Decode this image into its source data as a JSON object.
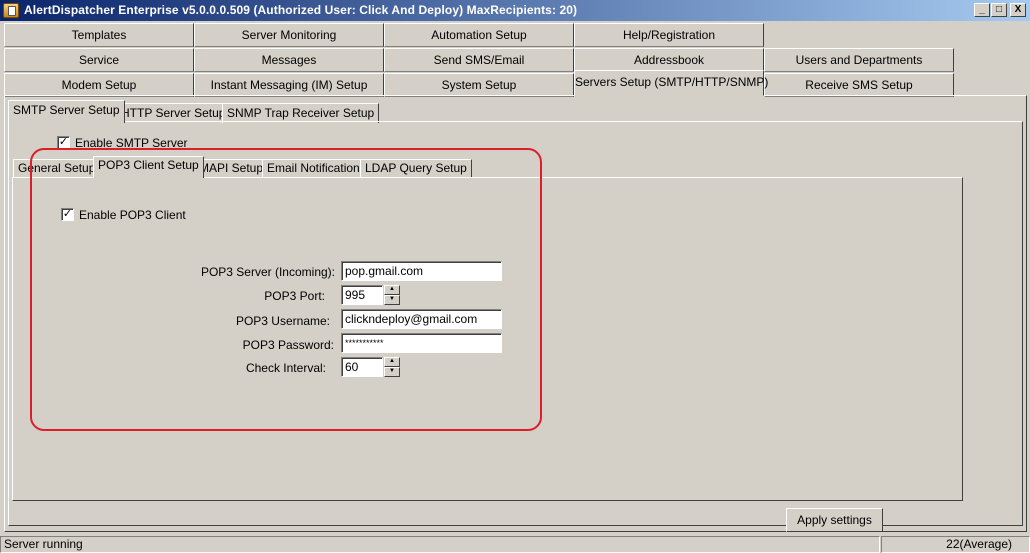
{
  "window": {
    "title": "AlertDispatcher Enterprise v5.0.0.0.509 (Authorized User: Click And Deploy)   MaxRecipients: 20)",
    "controls": {
      "minimize": "_",
      "maximize": "□",
      "close": "X"
    }
  },
  "main_tabs": {
    "row1": [
      "Templates",
      "Server Monitoring",
      "Automation Setup",
      "Help/Registration"
    ],
    "row2": [
      "Service",
      "Messages",
      "Send SMS/Email",
      "Addressbook",
      "Users and Departments"
    ],
    "row3": [
      "Modem Setup",
      "Instant Messaging (IM) Setup",
      "System Setup",
      "Servers Setup (SMTP/HTTP/SNMP)",
      "Receive SMS Setup"
    ],
    "active": "Servers Setup (SMTP/HTTP/SNMP)"
  },
  "server_tabs": {
    "items": [
      "SMTP Server Setup",
      "HTTP Server Setup",
      "SNMP Trap Receiver Setup"
    ],
    "active": "SMTP Server Setup"
  },
  "smtp": {
    "enable_label": "Enable SMTP Server",
    "enabled": true
  },
  "smtp_tabs": {
    "items": [
      "General Setup",
      "POP3 Client Setup",
      "MAPI Setup",
      "Email Notifications",
      "LDAP Query Setup"
    ],
    "active": "POP3 Client Setup"
  },
  "pop3": {
    "enable_label": "Enable POP3 Client",
    "enabled": true,
    "server_label": "POP3 Server (Incoming):",
    "server_value": "pop.gmail.com",
    "port_label": "POP3 Port:",
    "port_value": "995",
    "username_label": "POP3 Username:",
    "username_value": "clickndeploy@gmail.com",
    "password_label": "POP3 Password:",
    "password_value": "***********",
    "interval_label": "Check Interval:",
    "interval_value": "60"
  },
  "actions": {
    "apply_label": "Apply settings"
  },
  "status": {
    "left": "Server running",
    "right": "22(Average)"
  },
  "colors": {
    "highlight": "#dc1e28",
    "titlebar_start": "#0a246a",
    "titlebar_end": "#a6caf0",
    "face": "#d4d0c8"
  }
}
